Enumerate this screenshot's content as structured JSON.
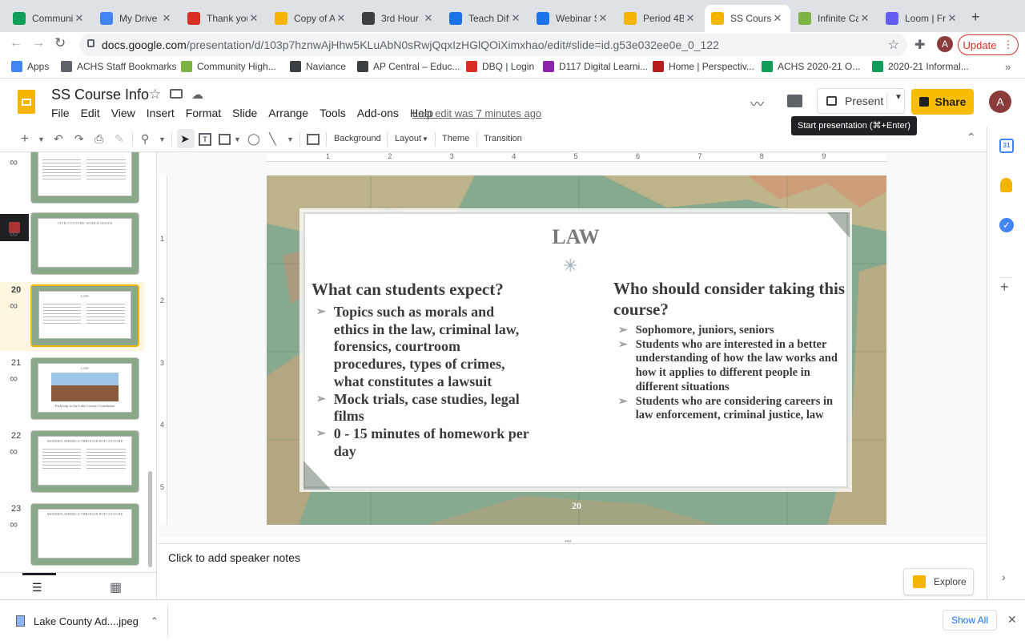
{
  "browser": {
    "tabs": [
      {
        "title": "Communit",
        "icon": "classroom-icon",
        "color": "#0f9d58"
      },
      {
        "title": "My Drive -",
        "icon": "drive-icon",
        "color": "#4285f4"
      },
      {
        "title": "Thank you",
        "icon": "gmail-icon",
        "color": "#d93025"
      },
      {
        "title": "Copy of A",
        "icon": "slides-icon",
        "color": "#f4b400"
      },
      {
        "title": "3rd Hour L",
        "icon": "classroom-icon",
        "color": "#3c4043"
      },
      {
        "title": "Teach Diff",
        "icon": "link-icon",
        "color": "#1a73e8"
      },
      {
        "title": "Webinar S",
        "icon": "wifi-icon",
        "color": "#1a73e8"
      },
      {
        "title": "Period 4B",
        "icon": "slides-icon",
        "color": "#f4b400"
      },
      {
        "title": "SS Course",
        "icon": "slides-icon",
        "color": "#f4b400"
      },
      {
        "title": "Infinite Ca",
        "icon": "c-icon",
        "color": "#7cb342"
      },
      {
        "title": "Loom | Fre",
        "icon": "loom-icon",
        "color": "#625df5"
      }
    ],
    "new_tab_label": "+",
    "url_host": "docs.google.com",
    "url_path": "/presentation/d/103p7hznwAjHhw5KLuAbN0sRwjQqxIzHGlQOiXimxhao/edit#slide=id.g53e032ee0e_0_122",
    "update_label": "Update",
    "profile_initial": "A"
  },
  "bookmarks": [
    {
      "label": "Apps",
      "color": "#4285f4"
    },
    {
      "label": "ACHS Staff Bookmarks",
      "color": "#5f6368"
    },
    {
      "label": "Community High...",
      "color": "#7cb342"
    },
    {
      "label": "Naviance",
      "color": "#3c4043"
    },
    {
      "label": "AP Central – Educ...",
      "color": "#3c4043"
    },
    {
      "label": "DBQ | Login",
      "color": "#d93025"
    },
    {
      "label": "D117 Digital Learni...",
      "color": "#8e24aa"
    },
    {
      "label": "Home | Perspectiv...",
      "color": "#b71c1c"
    },
    {
      "label": "ACHS 2020-21 O...",
      "color": "#0f9d58"
    },
    {
      "label": "2020-21 Informal...",
      "color": "#0f9d58"
    }
  ],
  "doc": {
    "title": "SS Course Info",
    "menu": [
      "File",
      "Edit",
      "View",
      "Insert",
      "Format",
      "Slide",
      "Arrange",
      "Tools",
      "Add-ons",
      "Help"
    ],
    "last_edit": "Last edit was 7 minutes ago",
    "present_label": "Present",
    "share_label": "Share",
    "tooltip": "Start presentation (⌘+Enter)",
    "avatar_initial": "A"
  },
  "toolbar": {
    "background": "Background",
    "layout": "Layout",
    "theme": "Theme",
    "transition": "Transition"
  },
  "ruler": [
    "1",
    "2",
    "3",
    "4",
    "5",
    "6",
    "7",
    "8",
    "9"
  ],
  "vruler": [
    "1",
    "2",
    "3",
    "4",
    "5"
  ],
  "filmstrip": [
    {
      "num": "",
      "caption": ""
    },
    {
      "num": "",
      "caption": "CIVIL/CULTURE: WORLD ISSUES"
    },
    {
      "num": "20",
      "caption": "LAW"
    },
    {
      "num": "21",
      "caption": "LAW"
    },
    {
      "num": "22",
      "caption": "MODERN AMERICA THROUGH POP CULTURE"
    },
    {
      "num": "23",
      "caption": "MODERN AMERICA THROUGH POP CULTURE"
    }
  ],
  "thumb21_note": "Field trip to the Lake County Courthouse",
  "slide": {
    "title": "LAW",
    "left_heading": "What can students expect?",
    "left_bullets": [
      "Topics such as morals and ethics in the law, criminal law, forensics, courtroom procedures, types of crimes, what constitutes a lawsuit",
      "Mock trials, case studies, legal films",
      "0 - 15 minutes of homework per day"
    ],
    "right_heading": "Who should consider taking this course?",
    "right_bullets": [
      "Sophomore, juniors, seniors",
      "Students who are interested in a better understanding of how the law works and how it applies to different people in different situations",
      "Students who are considering careers in law enforcement, criminal justice, law"
    ],
    "number": "20"
  },
  "notes_placeholder": "Click to add speaker notes",
  "explore_label": "Explore",
  "download": {
    "filename": "Lake County Ad....jpeg",
    "show_all": "Show All"
  }
}
